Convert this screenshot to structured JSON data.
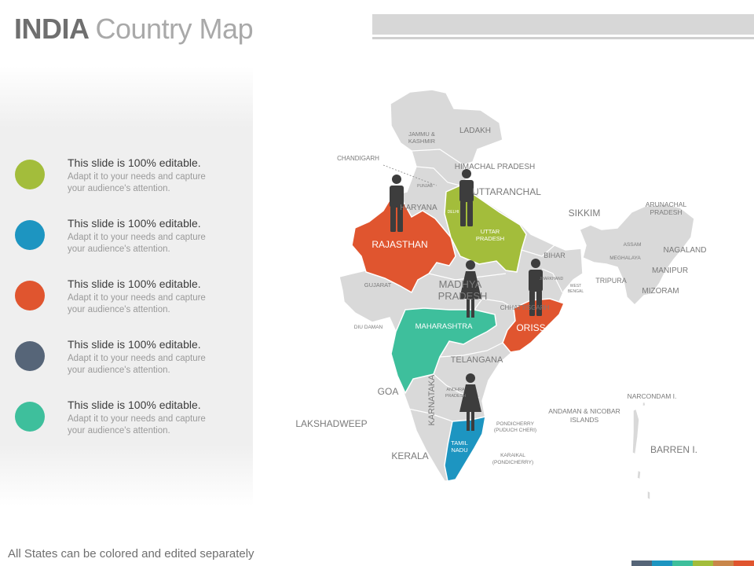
{
  "title": {
    "bold": "INDIA",
    "light": "Country Map"
  },
  "legend_items": [
    {
      "heading": "This slide is 100% editable.",
      "line1": "Adapt it to your needs and capture",
      "line2": "your audience's attention.",
      "color": "#a3bd3b"
    },
    {
      "heading": "This slide is 100% editable.",
      "line1": "Adapt it to your needs and capture",
      "line2": "your audience's attention.",
      "color": "#1d95c1"
    },
    {
      "heading": "This slide is 100% editable.",
      "line1": "Adapt it to your needs and capture",
      "line2": "your audience's attention.",
      "color": "#e0552f"
    },
    {
      "heading": "This slide is 100% editable.",
      "line1": "Adapt it to your needs and capture",
      "line2": "your audience's attention.",
      "color": "#566578"
    },
    {
      "heading": "This slide is 100% editable.",
      "line1": "Adapt it to your needs and capture",
      "line2": "your audience's attention.",
      "color": "#3ebf9c"
    }
  ],
  "footer": "All States can be colored and edited separately",
  "stripe_colors": [
    "#566578",
    "#1d95c1",
    "#3ebf9c",
    "#a3bd3b",
    "#c9864a",
    "#e0552f"
  ],
  "map_labels": {
    "ladakh": "LADAKH",
    "jk1": "JAMMU &",
    "jk2": "KASHMIR",
    "chandigarh": "CHANDIGARH",
    "himachal": "HIMACHAL PRADESH",
    "punjab": "PUNJAB",
    "uttaranchal": "UTTARANCHAL",
    "haryana": "HARYANA",
    "delhi": "DELHI",
    "rajasthan": "RAJASTHAN",
    "up1": "UTTAR",
    "up2": "PRADESH",
    "sikkim": "SIKKIM",
    "arunachal1": "ARUNACHAL",
    "arunachal2": "PRADESH",
    "assam": "ASSAM",
    "meghalaya": "MEGHALAYA",
    "nagaland": "NAGALAND",
    "manipur": "MANIPUR",
    "mizoram": "MIZORAM",
    "tripura": "TRIPURA",
    "bihar": "BIHAR",
    "jharkhand": "JHARKHAND",
    "wb1": "WEST",
    "wb2": "BENGAL",
    "gujarat": "GUJARAT",
    "mp1": "MADHYA",
    "mp2": "PRADESH",
    "chhattisgarh": "CHHATTISGARH",
    "diu": "DIU DAMAN",
    "maharashtra": "MAHARASHTRA",
    "orissa": "ORISSA",
    "telangana": "TELANGANA",
    "goa": "GOA",
    "karnataka": "KARNATAKA",
    "ap1": "ANDHRA",
    "ap2": "PRADESH",
    "lakshadweep": "LAKSHADWEEP",
    "kerala": "KERALA",
    "tn1": "TAMIL",
    "tn2": "NADU",
    "pondi1": "PONDICHERRY",
    "pondi2": "(PUDUCH CHERI)",
    "karaikal1": "KARAIKAL",
    "karaikal2": "(PONDICHERRY)",
    "andaman1": "ANDAMAN & NICOBAR",
    "andaman2": "ISLANDS",
    "narcondam": "NARCONDAM I.",
    "barren": "BARREN I."
  },
  "state_colors": {
    "base": "#d9d9d9",
    "rajasthan": "#e0552f",
    "uttar_pradesh": "#a3bd3b",
    "maharashtra": "#3ebf9c",
    "orissa": "#e0552f",
    "tamil_nadu": "#1d95c1",
    "person_icon": "#3d3d3d"
  }
}
